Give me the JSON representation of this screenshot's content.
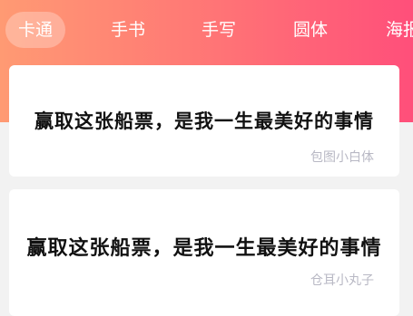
{
  "tabs": [
    {
      "label": "卡通",
      "active": true
    },
    {
      "label": "手书",
      "active": false
    },
    {
      "label": "手写",
      "active": false
    },
    {
      "label": "圆体",
      "active": false
    },
    {
      "label": "海报",
      "active": false
    }
  ],
  "cards": [
    {
      "sample_text": "赢取这张船票，是我一生最美好的事情",
      "font_name": "包图小白体"
    },
    {
      "sample_text": "赢取这张船票，是我一生最美好的事情",
      "font_name": "仓耳小丸子"
    }
  ],
  "colors": {
    "header_gradient_start": "#ff9a73",
    "header_gradient_end": "#ff4f7a",
    "page_background": "#f2f2f2",
    "font_name_text": "#b8b8c4"
  }
}
